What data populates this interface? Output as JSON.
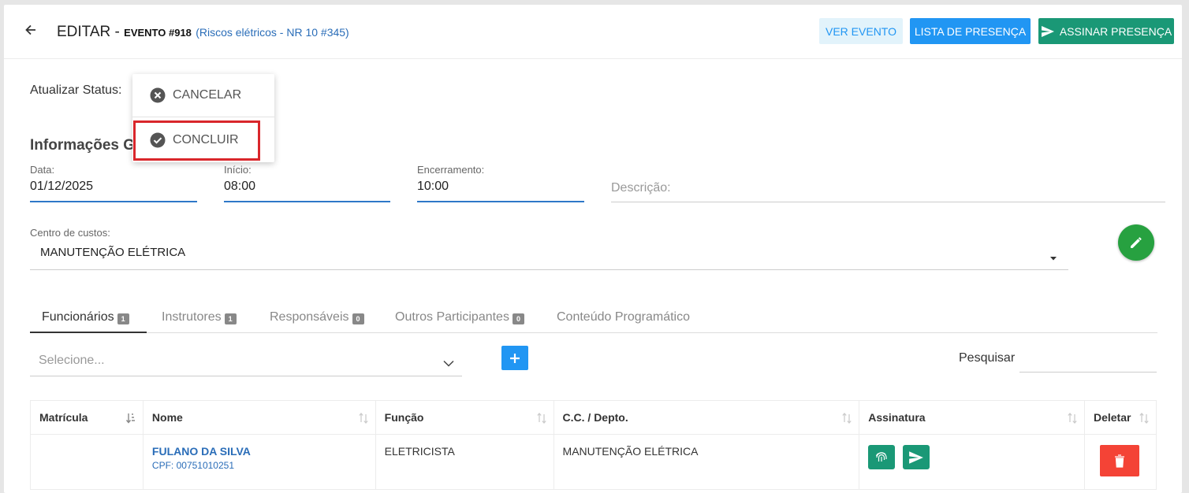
{
  "header": {
    "title": "EDITAR -",
    "event_number": "EVENTO #918",
    "event_link": "(Riscos elétricos - NR 10 #345)",
    "buttons": {
      "ver_evento": "VER EVENTO",
      "lista_presenca": "LISTA DE PRESENÇA",
      "assinar_presenca": "ASSINAR PRESENÇA"
    }
  },
  "status": {
    "label": "Atualizar Status:"
  },
  "status_menu": {
    "items": [
      {
        "label": "CANCELAR",
        "icon": "cancel-circle-icon"
      },
      {
        "label": "CONCLUIR",
        "icon": "check-circle-icon"
      }
    ]
  },
  "section": {
    "title": "Informações G"
  },
  "fields": {
    "data": {
      "label": "Data:",
      "value": "01/12/2025"
    },
    "inicio": {
      "label": "Início:",
      "value": "08:00"
    },
    "encerramento": {
      "label": "Encerramento:",
      "value": "10:00"
    },
    "descricao": {
      "placeholder": "Descrição:"
    },
    "centro_custos": {
      "label": "Centro de custos:",
      "value": "MANUTENÇÃO ELÉTRICA"
    }
  },
  "tabs": [
    {
      "label": "Funcionários",
      "count": "1"
    },
    {
      "label": "Instrutores",
      "count": "1"
    },
    {
      "label": "Responsáveis",
      "count": "0"
    },
    {
      "label": "Outros Participantes",
      "count": "0"
    },
    {
      "label": "Conteúdo Programático"
    }
  ],
  "participant_select": {
    "placeholder": "Selecione..."
  },
  "search": {
    "label": "Pesquisar",
    "value": ""
  },
  "table": {
    "columns": [
      "Matrícula",
      "Nome",
      "Função",
      "C.C. / Depto.",
      "Assinatura",
      "Deletar"
    ],
    "rows": [
      {
        "matricula": "",
        "nome": "FULANO DA SILVA",
        "cpf": "CPF: 00751010251",
        "funcao": "ELETRICISTA",
        "cc_depto": "MANUTENÇÃO ELÉTRICA"
      }
    ]
  },
  "colors": {
    "primary": "#2196f3",
    "teal": "#1a9876",
    "green": "#27a140",
    "danger": "#f44336",
    "highlight": "#d9262b",
    "link": "#2a6db8"
  }
}
